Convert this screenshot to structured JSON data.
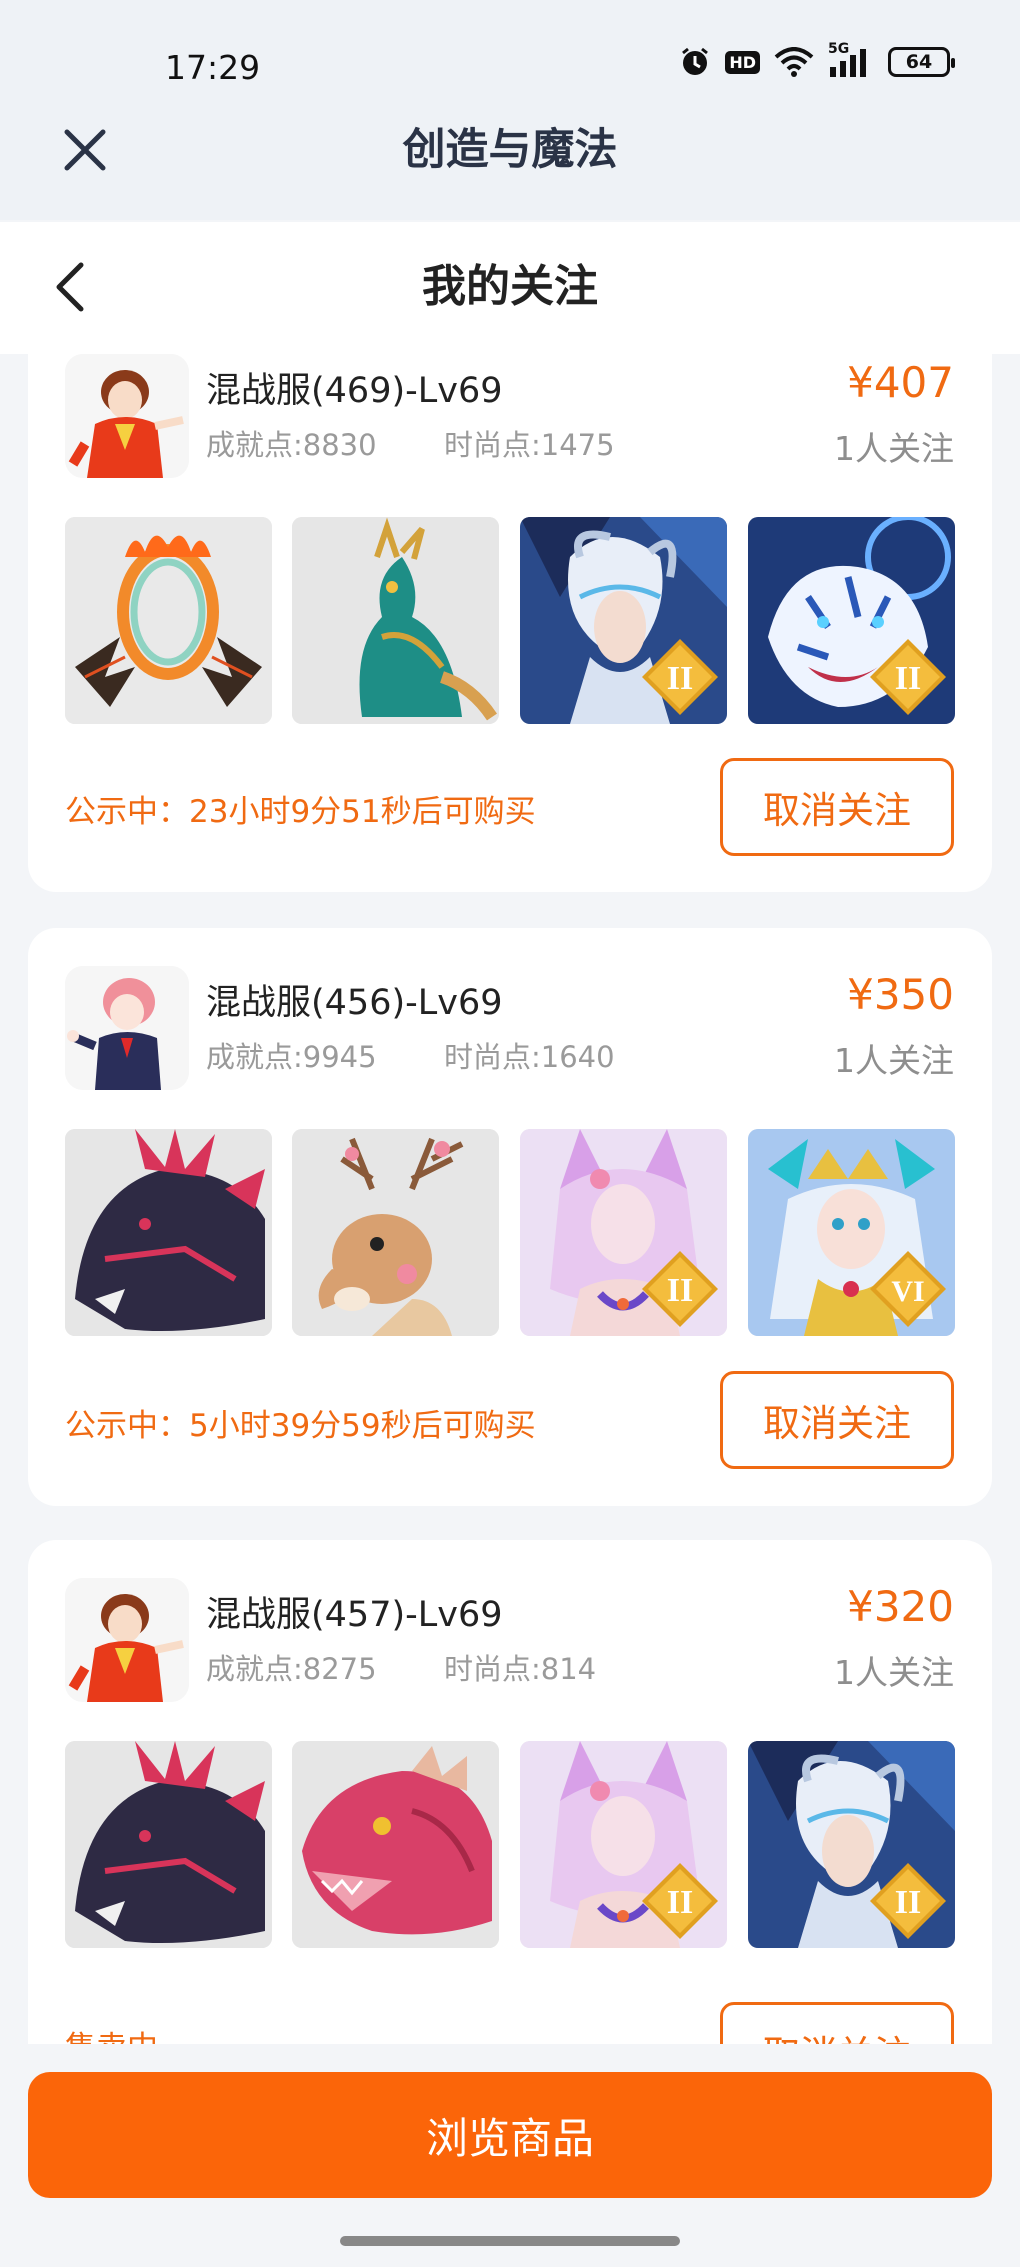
{
  "status_bar": {
    "time": "17:29",
    "network": "5G",
    "hd": "HD",
    "battery": "64"
  },
  "app": {
    "title": "创造与魔法"
  },
  "nav": {
    "title": "我的关注"
  },
  "listings": [
    {
      "server": "混战服(469)-Lv69",
      "achievement": "成就点:8830",
      "fashion": "时尚点:1475",
      "price": "¥407",
      "followers": "1人关注",
      "thumbs": [
        {
          "item": "flame-ring-wings"
        },
        {
          "item": "jade-dragon-mount"
        },
        {
          "item": "silver-dragon-helm-hero",
          "badge": "II"
        },
        {
          "item": "white-tiger-mount",
          "badge": "II"
        }
      ],
      "notice": "公示中：23小时9分51秒后可购买",
      "unfollow_label": "取消关注"
    },
    {
      "server": "混战服(456)-Lv69",
      "achievement": "成就点:9945",
      "fashion": "时尚点:1640",
      "price": "¥350",
      "followers": "1人关注",
      "thumbs": [
        {
          "item": "shadow-dragon-mount"
        },
        {
          "item": "blossom-deer-mount"
        },
        {
          "item": "fox-spirit-hero",
          "badge": "II"
        },
        {
          "item": "golden-crown-princess",
          "badge": "VI"
        }
      ],
      "notice": "公示中：5小时39分59秒后可购买",
      "unfollow_label": "取消关注"
    },
    {
      "server": "混战服(457)-Lv69",
      "achievement": "成就点:8275",
      "fashion": "时尚点:814",
      "price": "¥320",
      "followers": "1人关注",
      "thumbs": [
        {
          "item": "shadow-dragon-mount"
        },
        {
          "item": "ruby-dragon-mount"
        },
        {
          "item": "fox-spirit-hero",
          "badge": "II"
        },
        {
          "item": "silver-dragon-helm-hero",
          "badge": "II"
        }
      ],
      "notice": "售卖中",
      "unfollow_label": "取消关注"
    }
  ],
  "footer": {
    "browse_label": "浏览商品"
  },
  "colors": {
    "accent": "#f06a12",
    "button": "#fb6509",
    "title": "#2a3346"
  }
}
